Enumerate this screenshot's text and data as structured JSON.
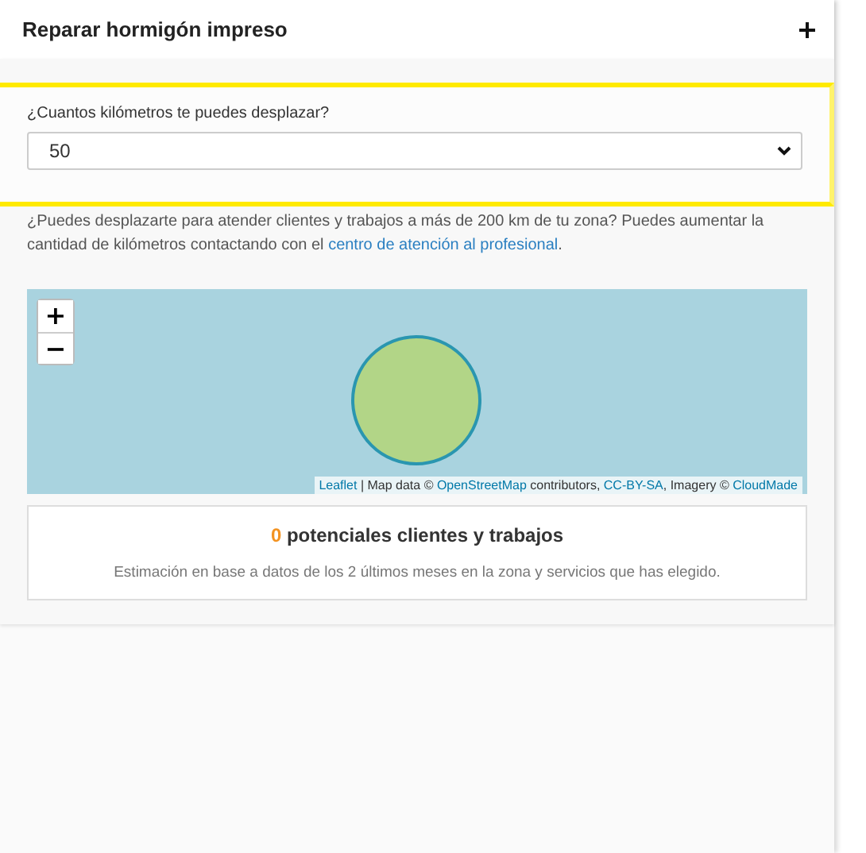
{
  "header": {
    "title": "Reparar hormigón impreso"
  },
  "distance": {
    "label": "¿Cuantos kilómetros te puedes desplazar?",
    "value": "50"
  },
  "info": {
    "text": "¿Puedes desplazarte para atender clientes y trabajos a más de 200 km de tu zona? Puedes aumentar la cantidad de kilómetros contactando con el ",
    "link": "centro de atención al profesional",
    "end": "."
  },
  "map": {
    "zoom_controls": [
      "+",
      "−"
    ],
    "attribution": [
      {
        "text": "Leaflet",
        "link": true
      },
      {
        "text": " | Map data © ",
        "link": false
      },
      {
        "text": "OpenStreetMap",
        "link": true
      },
      {
        "text": " contributors, ",
        "link": false
      },
      {
        "text": "CC-BY-SA",
        "link": true
      },
      {
        "text": ", Imagery © ",
        "link": false
      },
      {
        "text": "CloudMade",
        "link": true
      }
    ]
  },
  "result": {
    "count": "0",
    "title": "potenciales clientes y trabajos",
    "note": "Estimación en base a datos de los 2 últimos meses en la zona y servicios que has elegido."
  }
}
